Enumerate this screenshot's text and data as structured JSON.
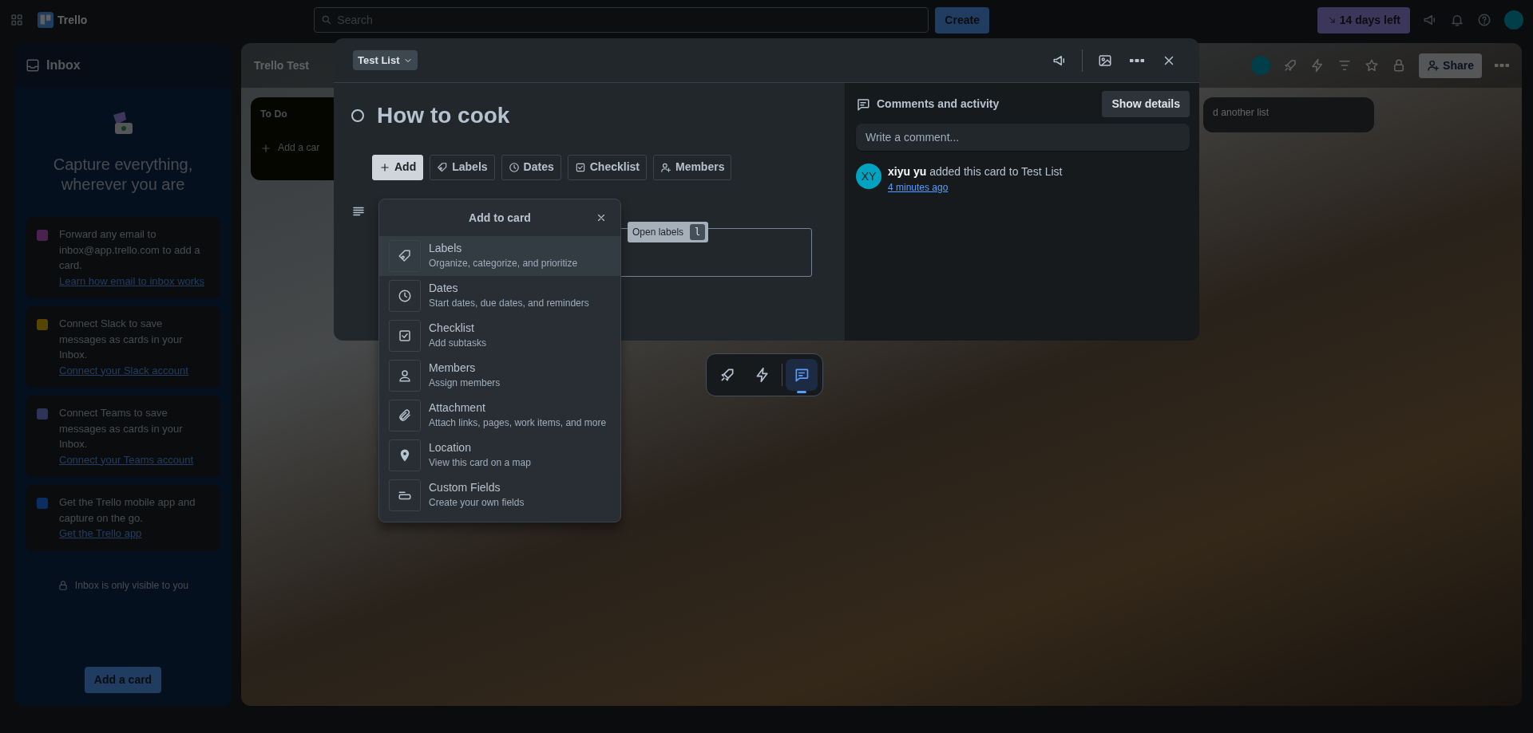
{
  "top_bar": {
    "app_name": "Trello",
    "search": {
      "placeholder": "Search"
    },
    "create_button": "Create",
    "trial_badge": "14 days left"
  },
  "inbox": {
    "title": "Inbox",
    "heading": "Capture everything, wherever you are",
    "items": [
      {
        "kind": "email",
        "text": "Forward any email to inbox@app.trello.com to add a card.",
        "link": "Learn how email to inbox works"
      },
      {
        "kind": "slack",
        "text": "Connect Slack to save messages as cards in your Inbox.",
        "link": "Connect your Slack account"
      },
      {
        "kind": "teams",
        "text": "Connect Teams to save messages as cards in your Inbox.",
        "link": "Connect your Teams account"
      },
      {
        "kind": "mobile",
        "text": "Get the Trello mobile app and capture on the go.",
        "link": "Get the Trello app"
      }
    ],
    "privacy_note": "Inbox is only visible to you",
    "add_button": "Add a card"
  },
  "board": {
    "title": "Trello Test",
    "lists": [
      {
        "title": "To Do",
        "add_card": "Add a car"
      }
    ],
    "add_list": "d another list",
    "share_button": "Share"
  },
  "card_modal": {
    "list_button": "Test List",
    "title": "How to cook",
    "complete": false,
    "actions": [
      {
        "kind": "add",
        "label": "Add",
        "selected": true
      },
      {
        "kind": "labels",
        "label": "Labels",
        "selected": false
      },
      {
        "kind": "dates",
        "label": "Dates",
        "selected": false
      },
      {
        "kind": "checklist",
        "label": "Checklist",
        "selected": false
      },
      {
        "kind": "members",
        "label": "Members",
        "selected": false
      }
    ],
    "activity": {
      "heading": "Comments and activity",
      "show_details": "Show details",
      "comment": {
        "placeholder": "Write a comment..."
      },
      "entries": [
        {
          "avatar": "XY",
          "user": "xiyu yu",
          "action": "added this card to Test List",
          "time": "4 minutes ago"
        }
      ]
    }
  },
  "add_menu": {
    "title": "Add to card",
    "items": [
      {
        "kind": "labels",
        "title": "Labels",
        "description": "Organize, categorize, and prioritize",
        "selected": true
      },
      {
        "kind": "dates",
        "title": "Dates",
        "description": "Start dates, due dates, and reminders",
        "selected": false
      },
      {
        "kind": "checklist",
        "title": "Checklist",
        "description": "Add subtasks",
        "selected": false
      },
      {
        "kind": "members",
        "title": "Members",
        "description": "Assign members",
        "selected": false
      },
      {
        "kind": "attachment",
        "title": "Attachment",
        "description": "Attach links, pages, work items, and more",
        "selected": false
      },
      {
        "kind": "location",
        "title": "Location",
        "description": "View this card on a map",
        "selected": false
      },
      {
        "kind": "custom_fields",
        "title": "Custom Fields",
        "description": "Create your own fields",
        "selected": false
      }
    ]
  },
  "tooltip": {
    "text": "Open labels",
    "shortcut": "l"
  },
  "bottom_toolbar": [
    {
      "kind": "rocket",
      "selected": false
    },
    {
      "kind": "bolt",
      "selected": false
    },
    {
      "kind": "comment",
      "selected": true
    }
  ]
}
